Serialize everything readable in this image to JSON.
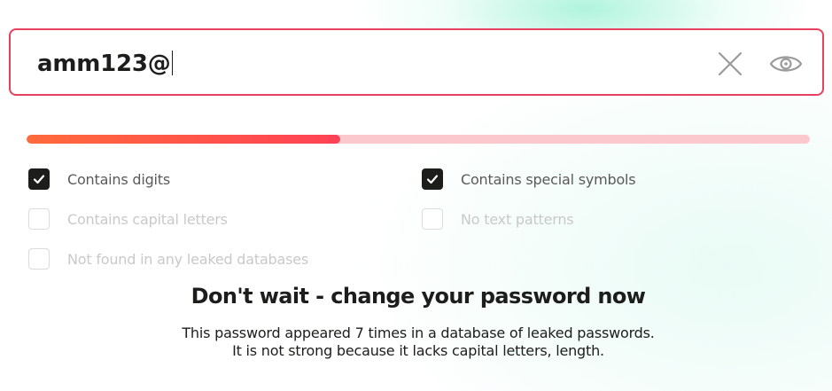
{
  "password_field": {
    "value": "amm123@",
    "clear_icon": "close-icon",
    "visibility_icon": "eye-icon",
    "border_color": "#e8415f"
  },
  "strength": {
    "progress": 0.4,
    "fill_color": "#ff4a50",
    "track_color": "#fbc9cd"
  },
  "criteria": [
    {
      "label": "Contains digits",
      "checked": true
    },
    {
      "label": "Contains special symbols",
      "checked": true
    },
    {
      "label": "Contains capital letters",
      "checked": false
    },
    {
      "label": "No text patterns",
      "checked": false
    },
    {
      "label": "Not found in any leaked databases",
      "checked": false
    }
  ],
  "verdict": {
    "title": "Don't wait - change your password now",
    "lines": [
      "This password appeared 7 times in a database of leaked passwords.",
      "It is not strong because it lacks capital letters, length."
    ]
  }
}
